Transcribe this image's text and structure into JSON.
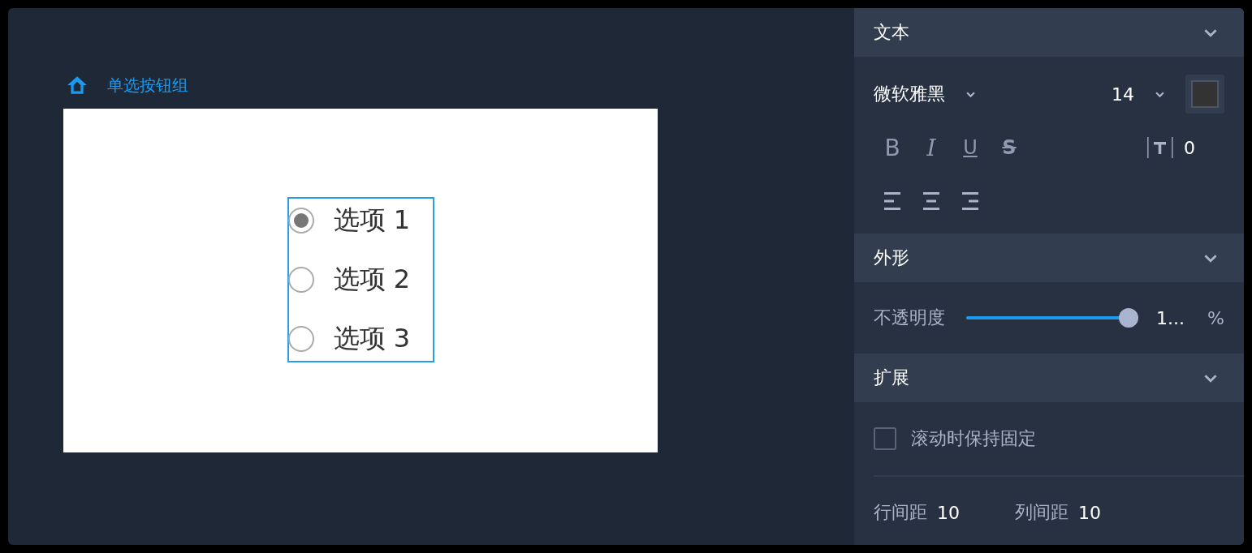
{
  "breadcrumb": {
    "label": "单选按钮组"
  },
  "radio_group": {
    "options": [
      {
        "label": "选项 1",
        "selected": true
      },
      {
        "label": "选项 2",
        "selected": false
      },
      {
        "label": "选项 3",
        "selected": false
      }
    ]
  },
  "panel": {
    "text_section": {
      "title": "文本",
      "font": "微软雅黑",
      "size": "14",
      "styles": [
        {
          "label": "B",
          "kind": "bold"
        },
        {
          "label": "I",
          "kind": "italic"
        },
        {
          "label": "U",
          "kind": "underline"
        },
        {
          "label": "S",
          "kind": "strike"
        }
      ],
      "letter_spacing": "0"
    },
    "shape_section": {
      "title": "外形",
      "opacity": {
        "label": "不透明度",
        "level": 1.0,
        "reading": "1...",
        "unit": "%"
      }
    },
    "extend_section": {
      "title": "扩展",
      "fixed": {
        "label": "滚动时保持固定",
        "checked": false
      },
      "row_gap": {
        "label": "行间距",
        "value": "10"
      },
      "column_gap": {
        "label": "列间距",
        "value": "10"
      }
    }
  }
}
